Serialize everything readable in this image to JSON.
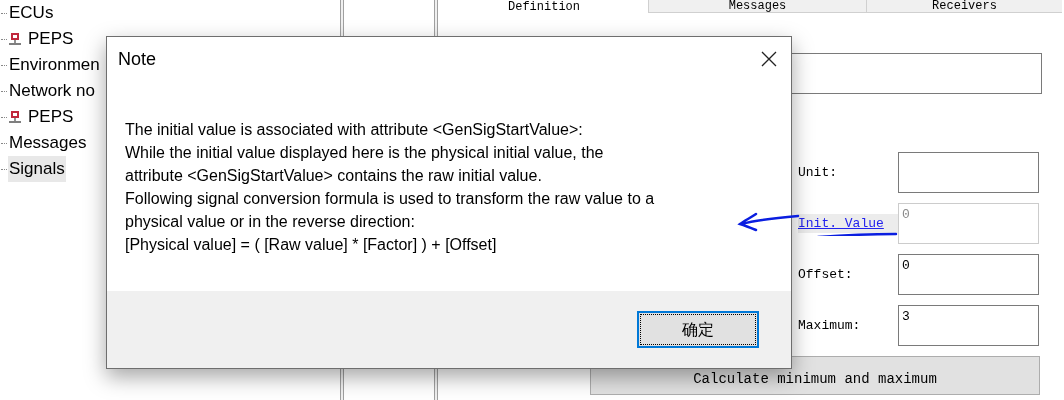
{
  "tree": {
    "items": [
      {
        "label": "ECUs",
        "icon": false,
        "selected": false
      },
      {
        "label": "PEPS",
        "icon": true,
        "selected": false
      },
      {
        "label": "Environmen",
        "icon": false,
        "selected": false
      },
      {
        "label": "Network no",
        "icon": false,
        "selected": false
      },
      {
        "label": "PEPS",
        "icon": true,
        "selected": false
      },
      {
        "label": "Messages",
        "icon": false,
        "selected": false
      },
      {
        "label": "Signals",
        "icon": false,
        "selected": true
      }
    ]
  },
  "tabs": [
    {
      "label": "Definition",
      "selected": true
    },
    {
      "label": "Messages",
      "selected": false
    },
    {
      "label": "Receivers",
      "selected": false
    }
  ],
  "form": {
    "fields": [
      {
        "kind": "label",
        "label": "Unit:",
        "disabled": false
      },
      {
        "kind": "link",
        "label": "Init. Value",
        "value": "0",
        "disabled": true
      },
      {
        "kind": "label",
        "label": "Offset:",
        "value": "0",
        "disabled": false
      },
      {
        "kind": "label",
        "label": "Maximum:",
        "value": "3",
        "disabled": false
      }
    ],
    "button": "Calculate minimum and maximum"
  },
  "dialog": {
    "title": "Note",
    "lines": [
      "The initial value is associated with attribute <GenSigStartValue>:",
      "While the initial value displayed here is the physical initial value, the",
      "attribute <GenSigStartValue> contains the raw initial value.",
      "Following signal conversion formula is used to transform the raw value to a",
      "physical value or in the reverse direction:",
      "[Physical value] = ( [Raw value] * [Factor] ) + [Offset]"
    ],
    "button": "确定"
  }
}
